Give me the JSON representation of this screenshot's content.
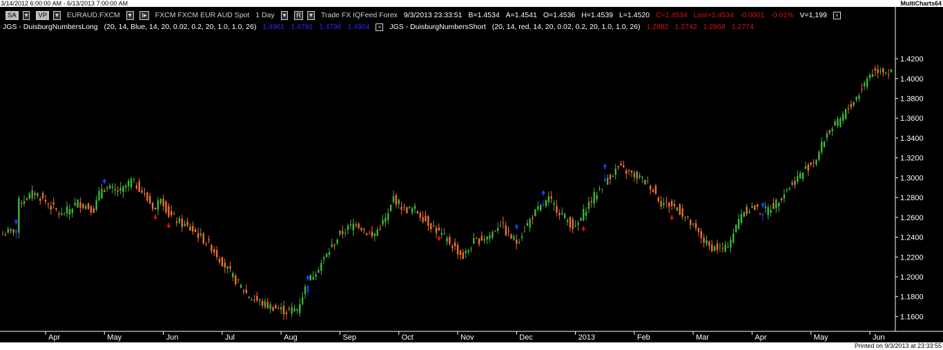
{
  "window": {
    "range": "3/14/2012 6:00:00 AM - 6/13/2013 7:00:00 AM",
    "app": "MultiCharts64"
  },
  "status": {
    "sa_label": "SA",
    "vp_label": "VP",
    "symbol": "EURAUD.FXCM",
    "description": "FXCM FXCM EUR AUD Spot",
    "resolution": "1 Day",
    "r_label": "R",
    "source": "Trade  FX  IQFeed  Forex",
    "datetime": "9/3/2013  23:33:51",
    "bid": "B=1.4534",
    "ask": "A=1.4541",
    "open": "O=1.4536",
    "high": "H=1.4539",
    "low": "L=1.4520",
    "close": "C=1.4534",
    "last": "Last=1.4534",
    "change": "-0.0001",
    "change_pct": "-0.01%",
    "volume": "V=1,199",
    "close_box": "×"
  },
  "studies": {
    "long_name": "JGS - DuisburgNumbersLong",
    "long_params": "(20, 14, Blue, 14, 20, 0.02, 0.2, 20, 1.0, 1.0, 26)",
    "long_values": [
      "1.4961",
      "1.4791",
      "1.4796",
      "1.4904"
    ],
    "short_box": "×",
    "short_name": "JGS - DuisburgNumbersShort",
    "short_params": "(20, 14, red, 14, 20, 0.02, 0.2, 20, 1.0, 1.0, 26)",
    "short_values": [
      "1.2882",
      "1.2742",
      "1.2868",
      "1.2774"
    ]
  },
  "footer": {
    "printed": "Printed on 9/3/2013 at 23:33:55"
  },
  "colors": {
    "background": "#000000",
    "up_bar": "#3db83d",
    "down_bar": "#f07030",
    "signal_bar": "#1f3cff",
    "long_arrow": "#1f3cff",
    "short_arrow": "#e01010",
    "axis": "#ffffff"
  },
  "chart_data": {
    "type": "candlestick",
    "symbol": "EURAUD.FXCM",
    "y_axis_side": "right",
    "ylim": [
      1.145,
      1.4305
    ],
    "y_ticks": [
      "1.4200",
      "1.4000",
      "1.3800",
      "1.3600",
      "1.3400",
      "1.3200",
      "1.3000",
      "1.2800",
      "1.2600",
      "1.2400",
      "1.2200",
      "1.2000",
      "1.1800",
      "1.1600"
    ],
    "x_ticks": [
      "Apr",
      "May",
      "Jun",
      "Jul",
      "Aug",
      "Sep",
      "Oct",
      "Nov",
      "Dec",
      "2013",
      "Feb",
      "Mar",
      "Apr",
      "May",
      "Jun"
    ],
    "x_tick_index": [
      16,
      38,
      60,
      82,
      104,
      126,
      148,
      170,
      192,
      214,
      236,
      258,
      280,
      302,
      324
    ],
    "bar_count": 333,
    "path_anchors": [
      [
        0,
        1.243
      ],
      [
        5,
        1.248
      ],
      [
        6,
        1.275
      ],
      [
        12,
        1.285
      ],
      [
        22,
        1.262
      ],
      [
        28,
        1.275
      ],
      [
        34,
        1.268
      ],
      [
        37,
        1.29
      ],
      [
        44,
        1.286
      ],
      [
        48,
        1.297
      ],
      [
        51,
        1.29
      ],
      [
        54,
        1.278
      ],
      [
        57,
        1.268
      ],
      [
        59,
        1.282
      ],
      [
        62,
        1.263
      ],
      [
        66,
        1.255
      ],
      [
        72,
        1.245
      ],
      [
        78,
        1.23
      ],
      [
        86,
        1.2
      ],
      [
        92,
        1.18
      ],
      [
        98,
        1.172
      ],
      [
        106,
        1.165
      ],
      [
        110,
        1.168
      ],
      [
        114,
        1.195
      ],
      [
        120,
        1.218
      ],
      [
        126,
        1.243
      ],
      [
        132,
        1.255
      ],
      [
        138,
        1.24
      ],
      [
        144,
        1.262
      ],
      [
        146,
        1.28
      ],
      [
        150,
        1.268
      ],
      [
        154,
        1.268
      ],
      [
        160,
        1.252
      ],
      [
        168,
        1.232
      ],
      [
        172,
        1.22
      ],
      [
        176,
        1.235
      ],
      [
        182,
        1.242
      ],
      [
        186,
        1.255
      ],
      [
        188,
        1.245
      ],
      [
        192,
        1.235
      ],
      [
        198,
        1.262
      ],
      [
        204,
        1.278
      ],
      [
        210,
        1.26
      ],
      [
        214,
        1.248
      ],
      [
        218,
        1.27
      ],
      [
        222,
        1.285
      ],
      [
        226,
        1.3
      ],
      [
        230,
        1.31
      ],
      [
        234,
        1.305
      ],
      [
        238,
        1.3
      ],
      [
        242,
        1.292
      ],
      [
        246,
        1.275
      ],
      [
        252,
        1.27
      ],
      [
        258,
        1.25
      ],
      [
        264,
        1.23
      ],
      [
        270,
        1.228
      ],
      [
        274,
        1.25
      ],
      [
        276,
        1.265
      ],
      [
        280,
        1.27
      ],
      [
        284,
        1.265
      ],
      [
        288,
        1.272
      ],
      [
        292,
        1.285
      ],
      [
        298,
        1.303
      ],
      [
        304,
        1.32
      ],
      [
        308,
        1.345
      ],
      [
        312,
        1.355
      ],
      [
        316,
        1.37
      ],
      [
        320,
        1.385
      ],
      [
        324,
        1.405
      ],
      [
        328,
        1.41
      ],
      [
        332,
        1.405
      ]
    ],
    "long_signals": [
      5,
      38,
      114,
      192,
      202,
      225,
      284
    ],
    "short_signals": [
      57,
      62,
      163,
      217,
      250
    ],
    "signal_bars": [
      5,
      114,
      202,
      225,
      284
    ]
  }
}
